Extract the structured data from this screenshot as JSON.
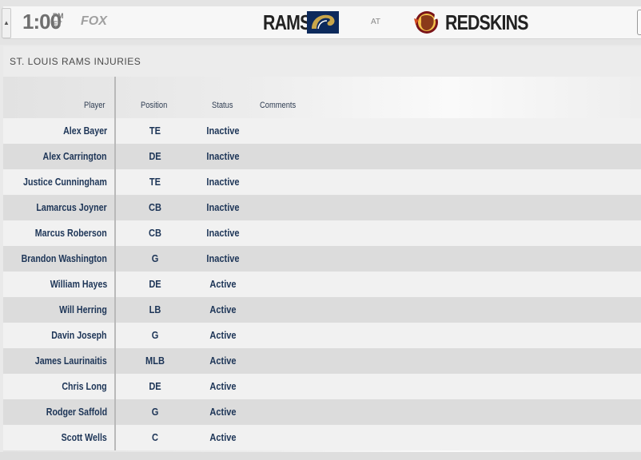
{
  "header": {
    "time": "1:00",
    "time_suffix_top": "PM",
    "time_suffix_bottom": "ET",
    "network": "FOX",
    "away_team": "RAMS",
    "at_label": "AT",
    "home_team": "REDSKINS",
    "away_logo_icon": "rams-horn-logo",
    "home_logo_icon": "redskins-head-logo"
  },
  "section": {
    "title": "ST. LOUIS RAMS INJURIES"
  },
  "table": {
    "columns": [
      "Player",
      "Position",
      "Status",
      "Comments"
    ],
    "rows": [
      {
        "player": "Alex Bayer",
        "position": "TE",
        "status": "Inactive",
        "comments": ""
      },
      {
        "player": "Alex Carrington",
        "position": "DE",
        "status": "Inactive",
        "comments": ""
      },
      {
        "player": "Justice Cunningham",
        "position": "TE",
        "status": "Inactive",
        "comments": ""
      },
      {
        "player": "Lamarcus Joyner",
        "position": "CB",
        "status": "Inactive",
        "comments": ""
      },
      {
        "player": "Marcus Roberson",
        "position": "CB",
        "status": "Inactive",
        "comments": ""
      },
      {
        "player": "Brandon Washington",
        "position": "G",
        "status": "Inactive",
        "comments": ""
      },
      {
        "player": "William Hayes",
        "position": "DE",
        "status": "Active",
        "comments": ""
      },
      {
        "player": "Will Herring",
        "position": "LB",
        "status": "Active",
        "comments": ""
      },
      {
        "player": "Davin Joseph",
        "position": "G",
        "status": "Active",
        "comments": ""
      },
      {
        "player": "James Laurinaitis",
        "position": "MLB",
        "status": "Active",
        "comments": ""
      },
      {
        "player": "Chris Long",
        "position": "DE",
        "status": "Active",
        "comments": ""
      },
      {
        "player": "Rodger Saffold",
        "position": "G",
        "status": "Active",
        "comments": ""
      },
      {
        "player": "Scott Wells",
        "position": "C",
        "status": "Active",
        "comments": ""
      }
    ]
  },
  "colors": {
    "text_navy": "#1d3557",
    "row_light": "#f1f1f1",
    "row_dark": "#dcdcdc"
  }
}
